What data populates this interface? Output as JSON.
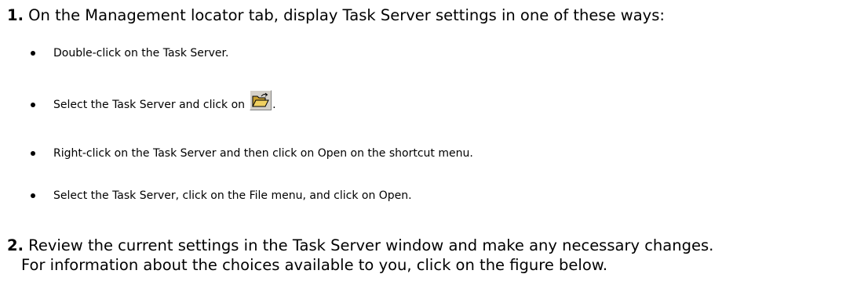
{
  "steps": [
    {
      "number": "1.",
      "text": " On the Management locator tab, display Task Server settings in one of these ways:"
    },
    {
      "number": "2.",
      "text": " Review the current settings in the Task Server window and make any necessary changes.",
      "continuation": "For information about the choices available to you, click on the figure below."
    }
  ],
  "bullets": [
    {
      "text": "Double-click on the Task Server."
    },
    {
      "text_before_icon": "Select the Task Server and click on",
      "text_after_icon": ".",
      "icon": "open-folder-icon"
    },
    {
      "text": "Right-click on the Task Server and then click on Open on the shortcut menu."
    },
    {
      "text": "Select the Task Server, click on the File menu, and click on Open."
    }
  ],
  "colors": {
    "text": "#000000",
    "toolbar_button": "#d4d0c8",
    "folder_yellow": "#f0d060",
    "folder_outline": "#000000"
  }
}
